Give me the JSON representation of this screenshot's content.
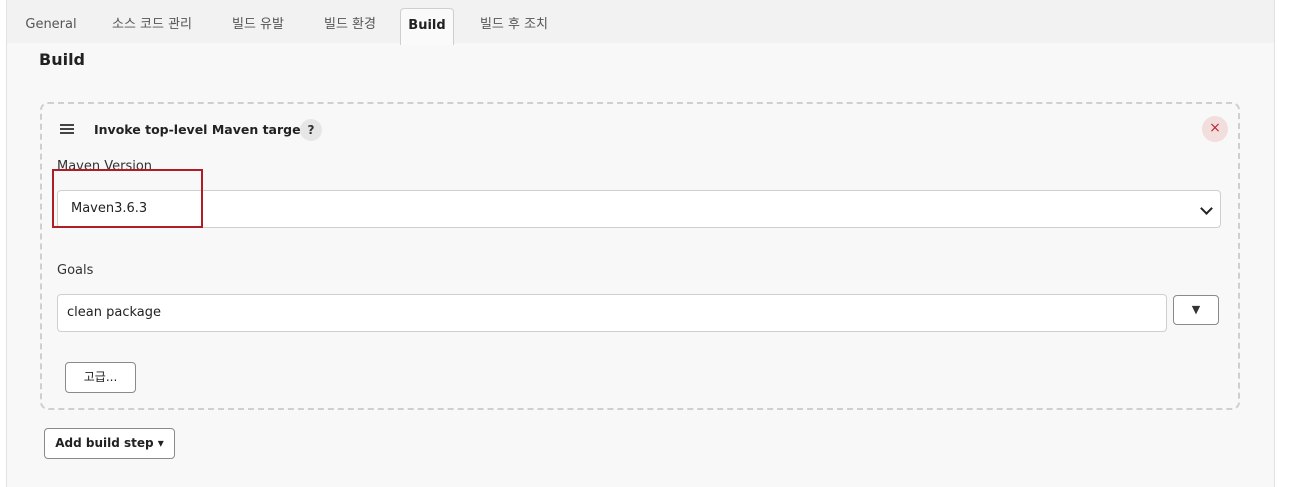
{
  "tabs": [
    {
      "label": "General"
    },
    {
      "label": "소스 코드 관리"
    },
    {
      "label": "빌드 유발"
    },
    {
      "label": "빌드 환경"
    },
    {
      "label": "Build"
    },
    {
      "label": "빌드 후 조치"
    }
  ],
  "active_tab": "Build",
  "section": {
    "title": "Build"
  },
  "build_step": {
    "title": "Invoke top-level Maven targets",
    "help_label": "?",
    "close_label": "×",
    "maven_version": {
      "label": "Maven Version",
      "value": "Maven3.6.3"
    },
    "goals": {
      "label": "Goals",
      "value": "clean package",
      "expand_label": "▼"
    },
    "advanced_label": "고급..."
  },
  "add_build_step": {
    "label": "Add build step ▾"
  },
  "colors": {
    "highlight": "#b01e25",
    "close_bg": "#f3dede",
    "close_fg": "#c0282f"
  }
}
